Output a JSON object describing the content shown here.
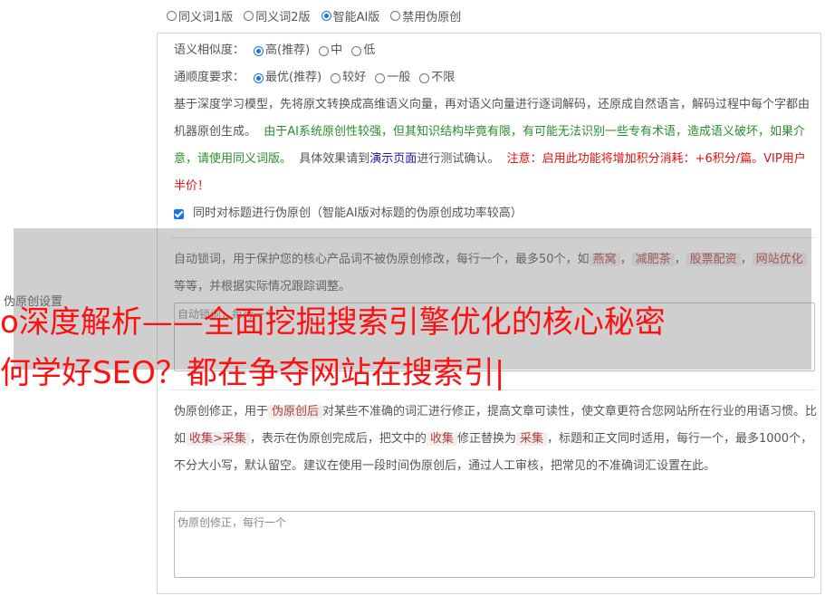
{
  "version_options": [
    {
      "label": "同义词1版",
      "selected": false
    },
    {
      "label": "同义词2版",
      "selected": false
    },
    {
      "label": "智能AI版",
      "selected": true
    },
    {
      "label": "禁用伪原创",
      "selected": false
    }
  ],
  "similarity": {
    "label": "语义相似度：",
    "options": [
      {
        "label": "高(推荐)",
        "selected": true
      },
      {
        "label": "中",
        "selected": false
      },
      {
        "label": "低",
        "selected": false
      }
    ]
  },
  "fluency": {
    "label": "通顺度要求：",
    "options": [
      {
        "label": "最优(推荐)",
        "selected": true
      },
      {
        "label": "较好",
        "selected": false
      },
      {
        "label": "一般",
        "selected": false
      },
      {
        "label": "不限",
        "selected": false
      }
    ]
  },
  "desc": {
    "p1": "基于深度学习模型，先将原文转换成高维语义向量，再对语义向量进行逐词解码，还原成自然语言，解码过程中每个字都由机器原创生成。",
    "p2_green_a": "由于AI系统原创性较强，但其知识结构毕竟有限，有可能无法识别一些专有术语，造成语义破坏，如果介意，请使用同义词版。",
    "p3_a": "具体效果请到",
    "p3_link": "演示页面",
    "p3_b": "进行测试确认。",
    "p4_red": "注意：启用此功能将增加积分消耗：+6积分/篇。VIP用户半价！"
  },
  "title_checkbox": {
    "label": "同时对标题进行伪原创（智能AI版对标题的伪原创成功率较高）",
    "checked": true
  },
  "lock_words": {
    "text_a": "自动锁词，用于保护您的核心产品词不被伪原创修改，每行一个，最多50个，如",
    "kw1": "燕窝",
    "kw2": "减肥茶",
    "kw3": "股票配资",
    "kw4": "网站优化",
    "text_b": "等等，并根据实际情况跟踪调整。",
    "placeholder": "自动锁词，每行一个"
  },
  "side_label": "伪原创设置",
  "correction": {
    "text_a": "伪原创修正，用于",
    "kw_a": "伪原创后",
    "text_b": "对某些不准确的词汇进行修正，提高文章可读性，使文章更符合您网站所在行业的用语习惯。比如",
    "kw_b": "收集>采集",
    "text_c": "，表示在伪原创完成后，把文中的",
    "kw_c": "收集",
    "text_d": "修正替换为",
    "kw_d": "采集",
    "text_e": "，标题和正文同时适用，每行一个，最多1000个，不分大小写，默认留空。建议在使用一段时间伪原创后，通过人工审核，把常见的不准确词汇设置在此。",
    "placeholder": "伪原创修正，每行一个"
  },
  "watermark": {
    "line1": "o深度解析——全面挖掘搜索引擎优化的核心秘密",
    "line2": "何学好SEO？都在争夺网站在搜索引|"
  },
  "colors": {
    "accent": "#1a73e8",
    "green": "#2e8b2e",
    "red": "#e01010",
    "link": "#1a1aa6"
  }
}
